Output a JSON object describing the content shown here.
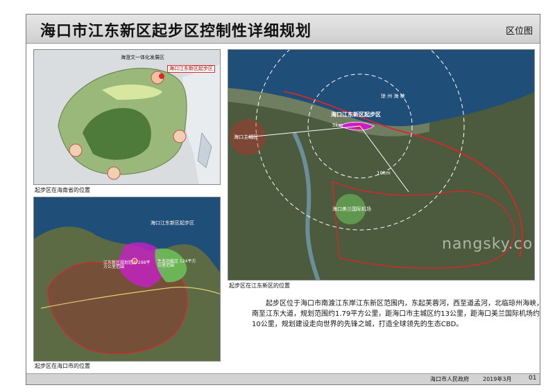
{
  "header": {
    "title": "海口市江东新区起步区控制性详细规划",
    "sheet_type": "区位图"
  },
  "panels": {
    "province": {
      "caption": "起步区在海南省的位置",
      "labels": {
        "zone_title": "海澄文一体化发展区",
        "site_callout": "海口江东新区起步区"
      }
    },
    "city": {
      "caption": "起步区在海口市的位置",
      "labels": {
        "new_area": "海口江东新区起步区",
        "district_a": "江东新区规划范围 298平方公里范围",
        "district_b": "生态功能区 124平方公里范围"
      }
    },
    "newarea": {
      "caption": "起步区在江东新区的位置",
      "labels": {
        "strait": "琼 州 海 峡",
        "site": "海口江东新区起步区",
        "main_city": "海口主城区",
        "airport": "海口美兰国际机场",
        "ring5": "5km",
        "ring10": "10km"
      }
    }
  },
  "description": "起步区位于海口市南渡江东岸江东新区范围内，东起芙蓉河，西至道孟河，北临琼州海峡，南至江东大道，规划范围约1.79平方公里，距海口市主城区约13公里，距海口美兰国际机场约10公里，规划建设走向世界的先锋之城，打造全球领先的生态CBD。",
  "footer": {
    "org": "海口市人民政府",
    "date": "2019年3月",
    "page": "01"
  },
  "colors": {
    "planning_boundary": "#d9262b",
    "site_highlight": "#c81fc8",
    "green_zone": "#6bbf59",
    "sea": "#1f4e79"
  }
}
